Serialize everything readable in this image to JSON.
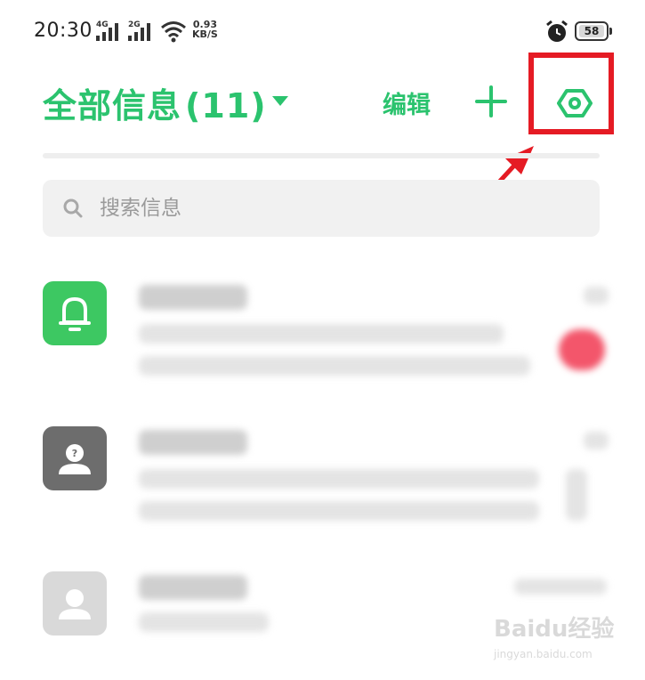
{
  "status_bar": {
    "time": "20:30",
    "network1": "4G",
    "network2": "2G",
    "speed_value": "0.93",
    "speed_unit": "KB/S",
    "battery": "58"
  },
  "header": {
    "title": "全部信息",
    "count": "(11)",
    "edit_label": "编辑",
    "add_icon": "plus-icon",
    "settings_icon": "settings-icon"
  },
  "search": {
    "placeholder": "搜索信息"
  },
  "conversations": [
    {
      "avatar_icon": "bell-icon",
      "avatar_color": "#3dc862",
      "unread": true
    },
    {
      "avatar_icon": "unknown-contact-icon",
      "avatar_color": "#6d6d6d",
      "unread": false
    },
    {
      "avatar_icon": "contact-icon",
      "avatar_color": "#d9d9d9",
      "unread": false
    }
  ],
  "colors": {
    "accent": "#2bc36e",
    "annotation": "#e51b24"
  },
  "watermark": {
    "logo": "Baidu经验",
    "url": "jingyan.baidu.com"
  }
}
